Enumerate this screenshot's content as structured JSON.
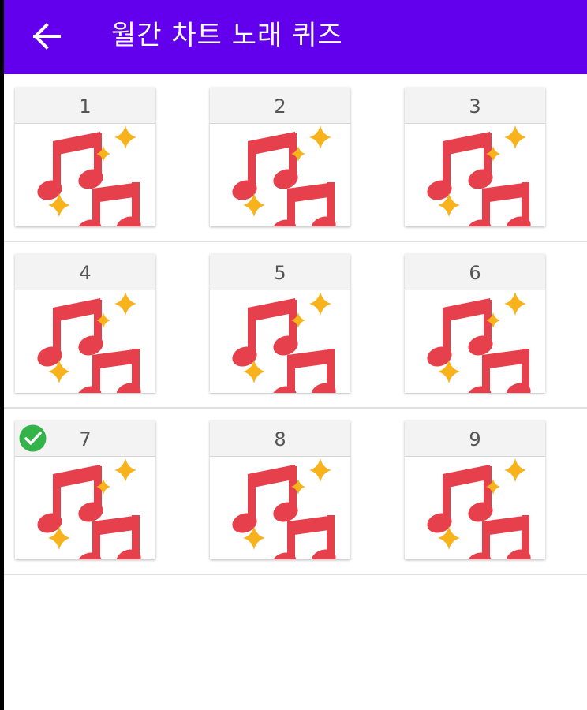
{
  "app_bar": {
    "title": "월간 차트 노래 퀴즈",
    "back_icon": "arrow-back-icon",
    "color": "#6200ee"
  },
  "quizzes": [
    {
      "number": "1",
      "icon": "musical-notes-icon",
      "completed": false
    },
    {
      "number": "2",
      "icon": "musical-notes-icon",
      "completed": false
    },
    {
      "number": "3",
      "icon": "musical-notes-icon",
      "completed": false
    },
    {
      "number": "4",
      "icon": "musical-notes-icon",
      "completed": false
    },
    {
      "number": "5",
      "icon": "musical-notes-icon",
      "completed": false
    },
    {
      "number": "6",
      "icon": "musical-notes-icon",
      "completed": false
    },
    {
      "number": "7",
      "icon": "musical-notes-icon",
      "completed": true
    },
    {
      "number": "8",
      "icon": "musical-notes-icon",
      "completed": false
    },
    {
      "number": "9",
      "icon": "musical-notes-icon",
      "completed": false
    }
  ],
  "colors": {
    "note": "#e5404c",
    "sparkle": "#f8b31c",
    "check": "#34b34a"
  }
}
